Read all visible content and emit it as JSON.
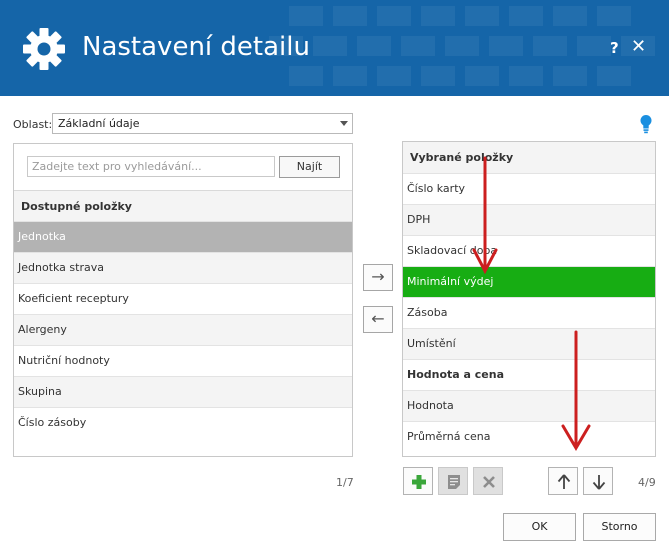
{
  "dialog": {
    "title": "Nastavení detailu",
    "help_glyph": "?",
    "close_glyph": "✕"
  },
  "area": {
    "label": "Oblast:",
    "selected": "Základní údaje"
  },
  "search": {
    "placeholder": "Zadejte text pro vyhledávání...",
    "button_label": "Najít"
  },
  "available": {
    "header": "Dostupné položky",
    "items": [
      {
        "label": "Jednotka",
        "state": "selected"
      },
      {
        "label": "Jednotka strava"
      },
      {
        "label": "Koeficient receptury"
      },
      {
        "label": "Alergeny"
      },
      {
        "label": "Nutriční hodnoty"
      },
      {
        "label": "Skupina"
      },
      {
        "label": "Číslo zásoby"
      }
    ],
    "page_indicator": "1/7"
  },
  "move_buttons": {
    "add_glyph": "→",
    "remove_glyph": "←"
  },
  "selected_items": {
    "header": "Vybrané položky",
    "items": [
      {
        "label": "Číslo karty"
      },
      {
        "label": "DPH"
      },
      {
        "label": "Skladovací doba"
      },
      {
        "label": "Minimální výdej",
        "state": "selected"
      },
      {
        "label": "Zásoba"
      },
      {
        "label": "Umístění"
      },
      {
        "label": "Hodnota a cena",
        "is_group": true
      },
      {
        "label": "Hodnota"
      },
      {
        "label": "Průměrná cena"
      }
    ],
    "page_indicator": "4/9"
  },
  "toolbar": {
    "add_icon": "plus-icon",
    "edit_icon": "note-icon",
    "delete_icon": "x-icon",
    "up_icon": "arrow-up-icon",
    "down_icon": "arrow-down-icon"
  },
  "footer": {
    "ok_label": "OK",
    "cancel_label": "Storno"
  },
  "colors": {
    "header_bg": "#1565a8",
    "selected_green": "#17ad13",
    "selected_gray": "#b3b3b3",
    "annotation_red": "#cc1f1f",
    "bulb_blue": "#1a8fe0"
  }
}
